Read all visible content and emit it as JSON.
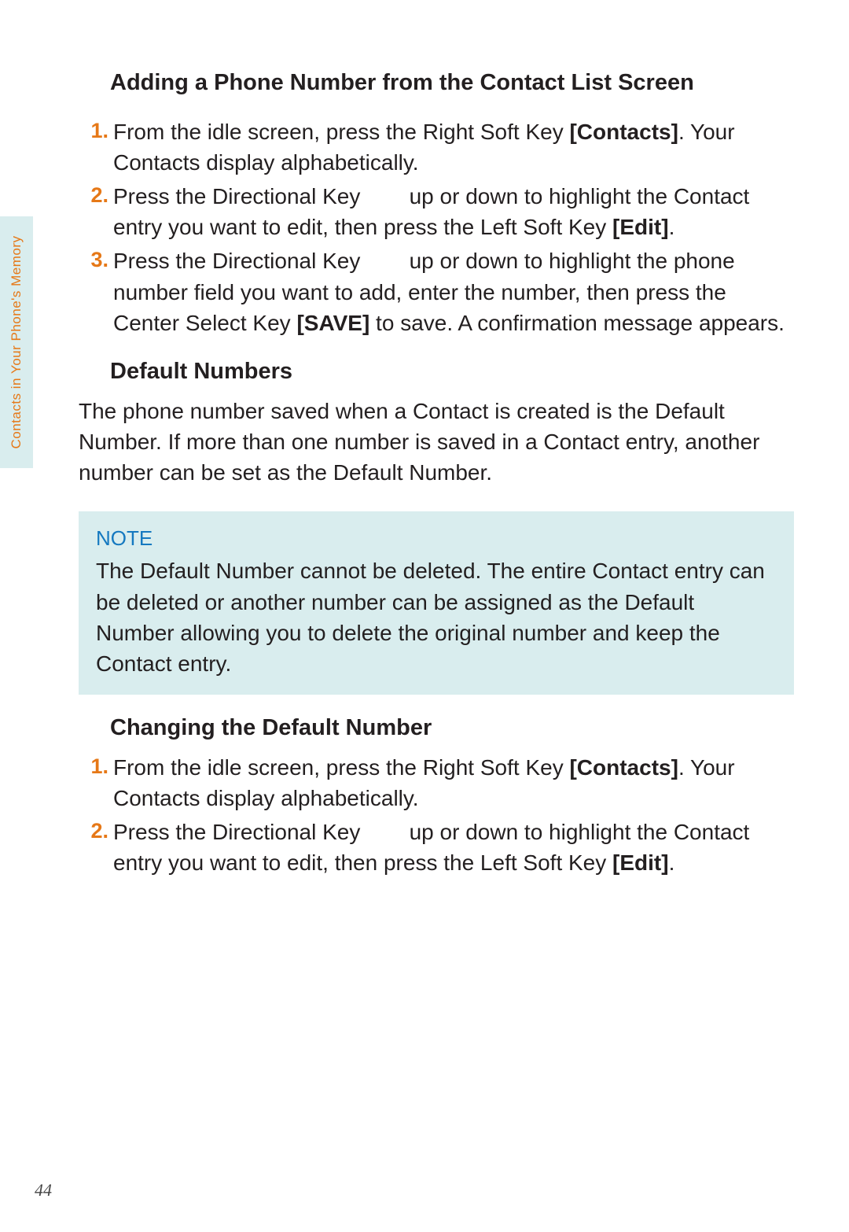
{
  "side_tab_label": "Contacts in Your Phone's Memory",
  "page_number": "44",
  "section1": {
    "heading": "Adding a Phone Number from the Contact List Screen",
    "steps": [
      {
        "num": "1.",
        "pre": "From the idle screen, press the Right Soft Key ",
        "bold1": "[Contacts]",
        "post": ". Your Contacts display alphabetically."
      },
      {
        "num": "2.",
        "pre": "Press the Directional Key ",
        "mid": " up or down to highlight the Contact entry you want to edit, then press the Left Soft Key ",
        "bold1": "[Edit]",
        "post": "."
      },
      {
        "num": "3.",
        "pre": "Press the Directional Key ",
        "mid": " up or down to highlight the phone number field you want to add, enter the number, then press the Center Select Key ",
        "bold1": "[SAVE]",
        "post": " to save. A confirmation message appears."
      }
    ]
  },
  "section2": {
    "heading": "Default Numbers",
    "text": "The phone number saved when a Contact is created is the Default Number. If more than one number is saved in a Contact entry, another number can be set as the Default Number."
  },
  "note": {
    "label": "NOTE",
    "text": "The Default Number cannot be deleted. The entire Contact entry can be deleted or another number can be assigned as the Default Number allowing you to delete the original number and keep the Contact entry."
  },
  "section3": {
    "heading": "Changing the Default Number",
    "steps": [
      {
        "num": "1.",
        "pre": "From the idle screen, press the Right Soft Key ",
        "bold1": "[Contacts]",
        "post": ". Your Contacts display alphabetically."
      },
      {
        "num": "2.",
        "pre": "Press the Directional Key ",
        "mid": " up or down to highlight the Contact entry you want to edit, then press the Left Soft Key ",
        "bold1": "[Edit]",
        "post": "."
      }
    ]
  }
}
